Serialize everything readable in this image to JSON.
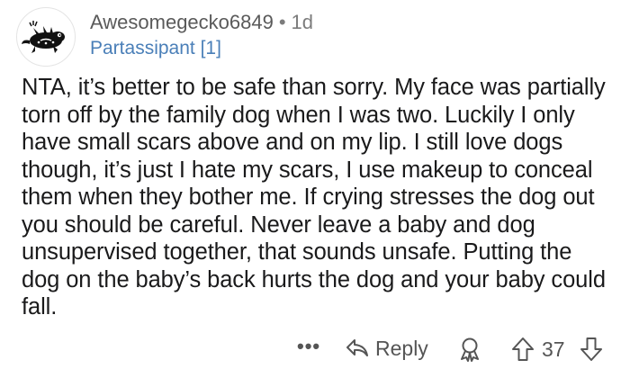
{
  "comment": {
    "username": "Awesomegecko6849",
    "separator": "•",
    "age": "1d",
    "flair": "Partassipant [1]",
    "body": "NTA, it’s better to be safe than sorry. My face was partially torn off by the family dog when I was two. Luckily I only have small scars above and on my lip. I still love dogs though, it’s just I hate my scars, I use makeup to conceal them when they bother me. If crying stresses the dog out you should be careful. Never leave a baby and dog unsupervised together, that sounds unsafe. Putting the dog on the baby’s back hurts the dog and your baby could fall."
  },
  "actions": {
    "more_label": "•••",
    "reply_label": "Reply",
    "score": "37"
  },
  "icons": {
    "avatar": "gecko-avatar-icon",
    "more": "more-options-icon",
    "reply": "reply-arrow-icon",
    "award": "award-icon",
    "upvote": "upvote-arrow-icon",
    "downvote": "downvote-arrow-icon"
  },
  "colors": {
    "text": "#1a1a1b",
    "meta": "#7c7c7c",
    "flair": "#4a7fb8",
    "background": "#ffffff"
  }
}
